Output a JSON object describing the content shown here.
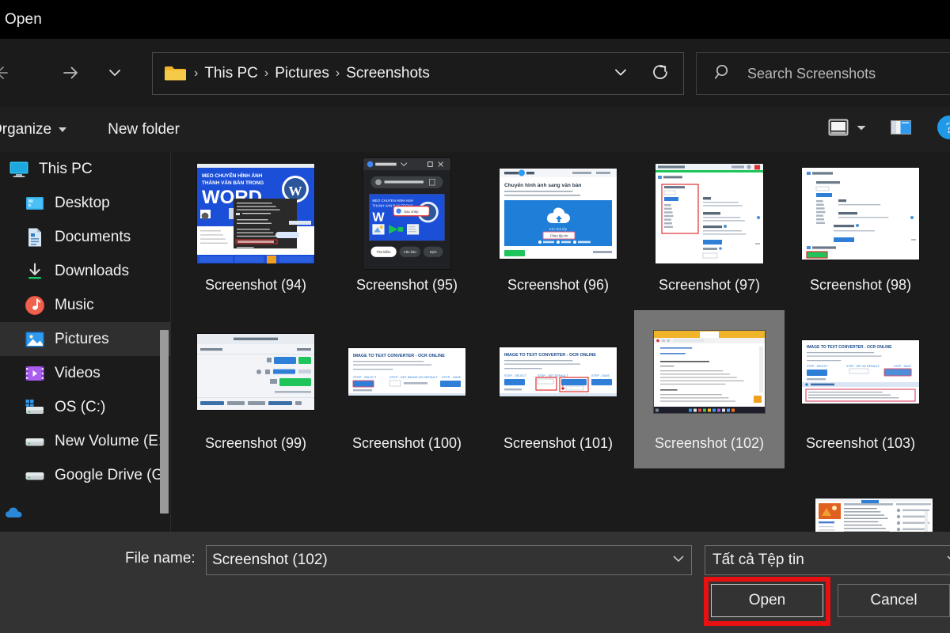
{
  "window": {
    "title": "Open"
  },
  "nav": {
    "back_icon": "arrow-left-icon",
    "forward_icon": "arrow-right-icon",
    "recent_icon": "chevron-down-icon",
    "up_icon": "arrow-up-icon",
    "refresh_icon": "refresh-icon",
    "address_dropdown_icon": "chevron-down-icon"
  },
  "breadcrumb": {
    "folder_icon": "folder-icon",
    "separator": "›",
    "items": [
      {
        "label": "This PC"
      },
      {
        "label": "Pictures"
      },
      {
        "label": "Screenshots"
      }
    ]
  },
  "search": {
    "icon": "search-icon",
    "placeholder": "Search Screenshots",
    "value": ""
  },
  "toolbar": {
    "organize_label": "Organize",
    "new_folder_label": "New folder",
    "view_icon": "view-layout-icon",
    "view_dropdown_icon": "chevron-down-icon",
    "preview_pane_icon": "preview-pane-icon",
    "help_icon": "help-icon"
  },
  "sidebar": {
    "items": [
      {
        "label": "This PC",
        "icon": "monitor-icon",
        "selected": false,
        "sub": false
      },
      {
        "label": "Desktop",
        "icon": "desktop-icon",
        "selected": false,
        "sub": true
      },
      {
        "label": "Documents",
        "icon": "documents-icon",
        "selected": false,
        "sub": true
      },
      {
        "label": "Downloads",
        "icon": "downloads-icon",
        "selected": false,
        "sub": true
      },
      {
        "label": "Music",
        "icon": "music-icon",
        "selected": false,
        "sub": true
      },
      {
        "label": "Pictures",
        "icon": "pictures-icon",
        "selected": true,
        "sub": true
      },
      {
        "label": "Videos",
        "icon": "videos-icon",
        "selected": false,
        "sub": true
      },
      {
        "label": "OS (C:)",
        "icon": "os-drive-icon",
        "selected": false,
        "sub": true
      },
      {
        "label": "New Volume (E:)",
        "icon": "drive-icon",
        "selected": false,
        "sub": true
      },
      {
        "label": "Google Drive (G",
        "icon": "drive-icon",
        "selected": false,
        "sub": true
      }
    ],
    "overflow_icon": "onedrive-cloud-icon"
  },
  "files": {
    "rows": [
      [
        {
          "label": "Screenshot (94)",
          "selected": false,
          "thumb": "word-tip-article"
        },
        {
          "label": "Screenshot (95)",
          "selected": false,
          "thumb": "google-lens-panel"
        },
        {
          "label": "Screenshot (96)",
          "selected": false,
          "thumb": "upload-converter-page"
        },
        {
          "label": "Screenshot (97)",
          "selected": false,
          "thumb": "settings-dropdown-page"
        },
        {
          "label": "Screenshot (98)",
          "selected": false,
          "thumb": "settings-form-page"
        }
      ],
      [
        {
          "label": "Screenshot (99)",
          "selected": false,
          "thumb": "order-dialog"
        },
        {
          "label": "Screenshot (100)",
          "selected": false,
          "thumb": "image-to-text-wide"
        },
        {
          "label": "Screenshot (101)",
          "selected": false,
          "thumb": "image-to-text-marked"
        },
        {
          "label": "Screenshot (102)",
          "selected": true,
          "thumb": "browser-desktop"
        },
        {
          "label": "Screenshot (103)",
          "selected": false,
          "thumb": "image-to-text-result"
        }
      ],
      [
        {
          "label": "",
          "selected": false,
          "thumb": "article-page"
        }
      ]
    ]
  },
  "footer": {
    "file_name_label": "File name:",
    "file_name_value": "Screenshot (102)",
    "file_name_dropdown_icon": "chevron-down-icon",
    "file_type_value": "Tất cả Tệp tin",
    "file_type_dropdown_icon": "chevron-down-icon",
    "open_label": "Open",
    "cancel_label": "Cancel"
  },
  "annotation": {
    "highlight_color": "#e81010",
    "target": "open-button"
  },
  "colors": {
    "titlebar_bg": "#000000",
    "dialog_bg": "#1b1b1b",
    "toolbar_bg": "#1f1f1f",
    "footer_bg": "#333333",
    "selection_bg": "#757575",
    "sidebar_selection_bg": "#2f2f2f",
    "text": "#f2f2f2",
    "accent_red": "#e81010"
  }
}
